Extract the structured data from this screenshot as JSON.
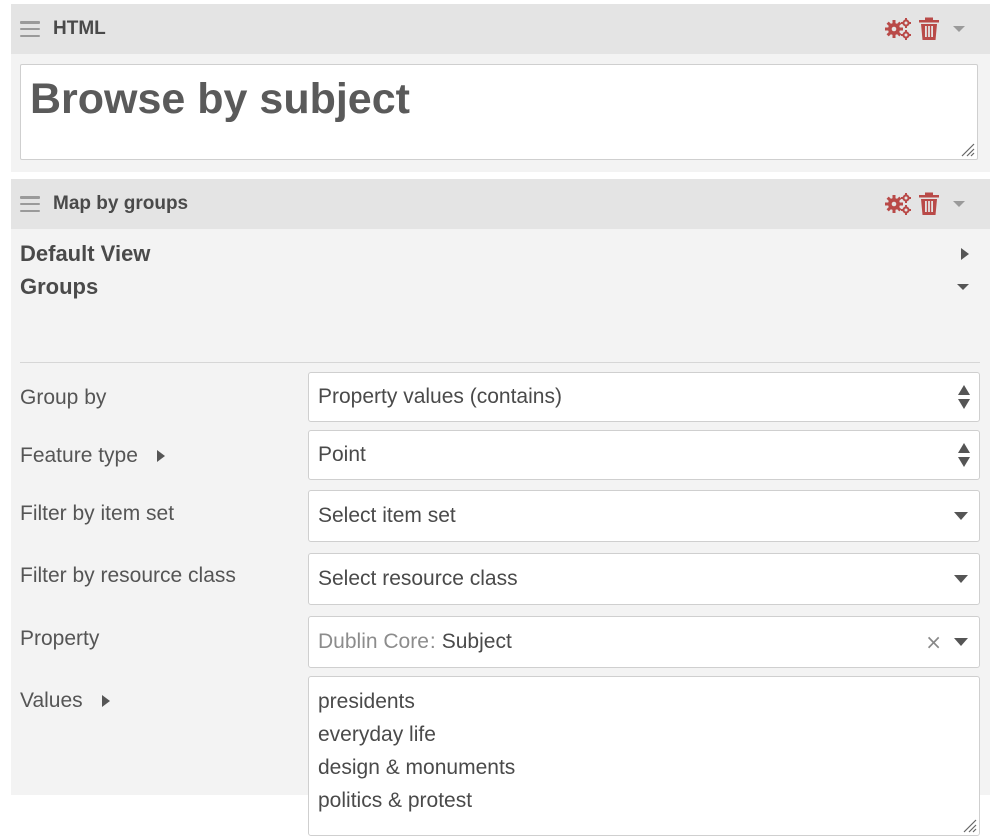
{
  "html_block": {
    "title": "HTML",
    "content": "Browse by subject"
  },
  "map_block": {
    "title": "Map by groups",
    "sections": {
      "default_view": "Default View",
      "groups": "Groups"
    },
    "fields": {
      "group_by": {
        "label": "Group by",
        "value": "Property values (contains)"
      },
      "feature_type": {
        "label": "Feature type",
        "value": "Point"
      },
      "filter_item_set": {
        "label": "Filter by item set",
        "value": "Select item set"
      },
      "filter_resource_class": {
        "label": "Filter by resource class",
        "value": "Select resource class"
      },
      "property": {
        "label": "Property",
        "vocabulary": "Dublin Core",
        "separator": ":",
        "value": "Subject",
        "clear": "×"
      },
      "values": {
        "label": "Values",
        "lines": [
          "presidents",
          "everyday life",
          "design & monuments",
          "politics & protest"
        ]
      }
    }
  },
  "icons": {
    "drag": "drag-handle-icon",
    "settings": "gears-icon",
    "delete": "trash-icon",
    "collapse": "caret-down-icon"
  },
  "colors": {
    "action_red": "#b94a48",
    "header_bg": "#e4e4e4",
    "panel_bg": "#f3f3f3"
  }
}
